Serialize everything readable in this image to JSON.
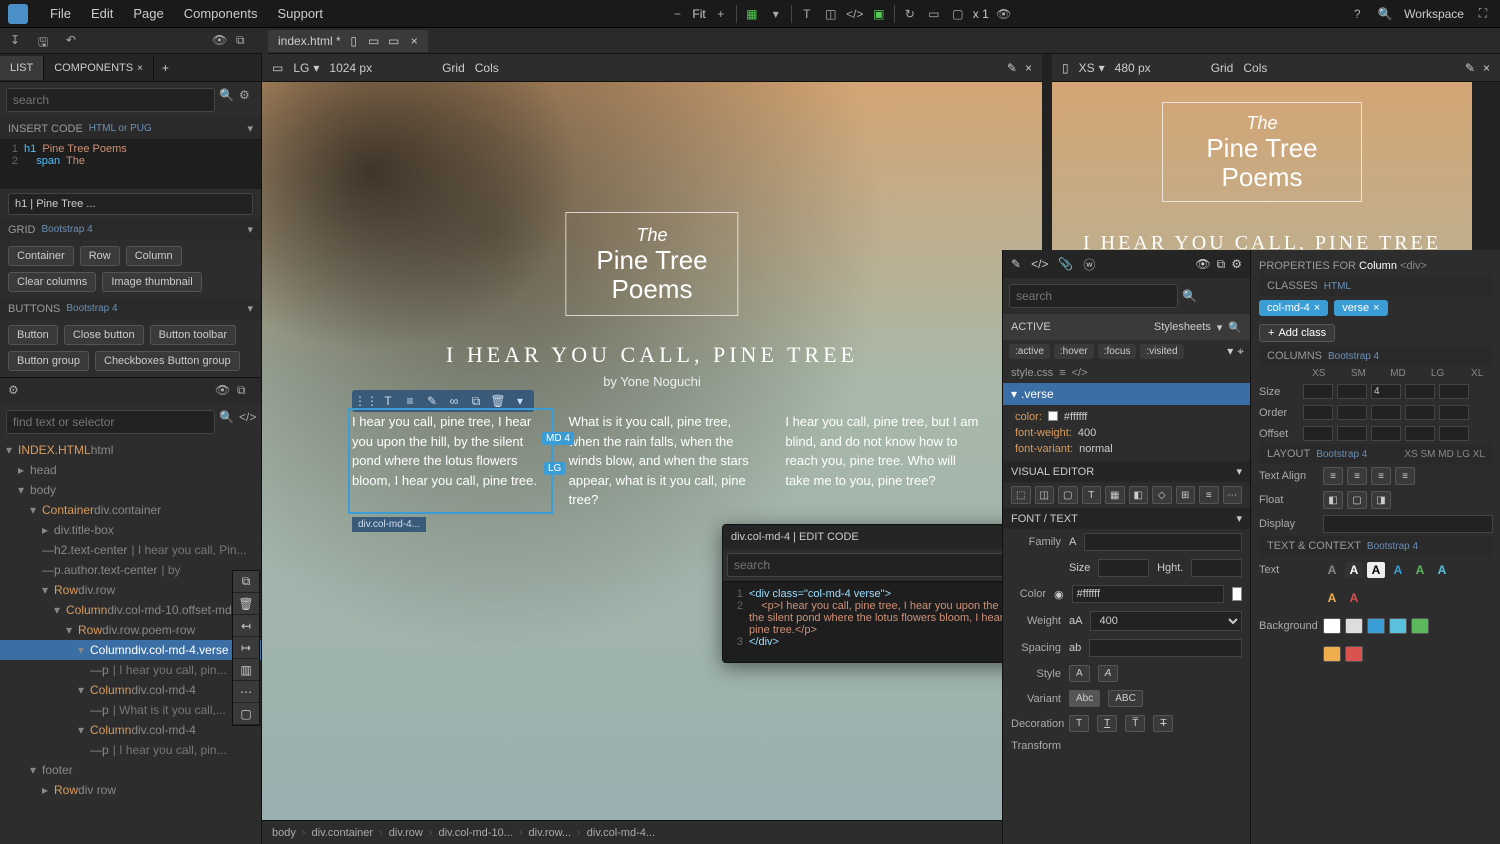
{
  "menubar": {
    "items": [
      "File",
      "Edit",
      "Page",
      "Components",
      "Support"
    ],
    "fit": "Fit",
    "x1": "x 1",
    "workspace": "Workspace"
  },
  "tab": {
    "filename": "index.html *"
  },
  "leftPanel": {
    "tabs": {
      "list": "LIST",
      "components": "COMPONENTS"
    },
    "searchPlaceholder": "search",
    "insertCode": {
      "label": "INSERT CODE",
      "sub": "HTML or PUG"
    },
    "codeLines": {
      "l1a": "h1",
      "l1b": "Pine Tree Poems",
      "l2a": "span",
      "l2b": "The"
    },
    "selectorPreview": "h1 | Pine Tree ...",
    "grid": {
      "label": "GRID",
      "sub": "Bootstrap 4",
      "buttons": [
        "Container",
        "Row",
        "Column",
        "Clear columns",
        "Image thumbnail"
      ]
    },
    "buttons": {
      "label": "BUTTONS",
      "sub": "Bootstrap 4",
      "buttons": [
        "Button",
        "Close button",
        "Button toolbar",
        "Button group",
        "Checkboxes Button group"
      ]
    },
    "treeSearchPlaceholder": "find text or selector",
    "treeRoot": {
      "file": "INDEX.HTML",
      "ext": "html"
    },
    "tree": {
      "head": "head",
      "body": "body",
      "container": {
        "tag": "Container",
        "cls": "div.container"
      },
      "titleBox": {
        "tag": "div.title-box"
      },
      "h2": {
        "tag": "h2.text-center",
        "text": "I hear you call, Pin..."
      },
      "author": {
        "tag": "p.author.text-center",
        "text": "by"
      },
      "row": {
        "tag": "Row",
        "cls": "div.row"
      },
      "col10": {
        "tag": "Column",
        "cls": "div.col-md-10.offset-md..."
      },
      "poemRow": {
        "tag": "Row",
        "cls": "div.row.poem-row"
      },
      "col4verse": {
        "tag": "Column",
        "cls": "div.col-md-4.verse"
      },
      "p1": {
        "tag": "p",
        "text": "I hear you call, pin..."
      },
      "col4b": {
        "tag": "Column",
        "cls": "div.col-md-4"
      },
      "p2": {
        "tag": "p",
        "text": "What is it you call,..."
      },
      "col4c": {
        "tag": "Column",
        "cls": "div.col-md-4"
      },
      "p3": {
        "tag": "p",
        "text": "I hear you call, pin..."
      },
      "footer": "footer",
      "rowLast": {
        "tag": "Row",
        "cls": "div row"
      }
    }
  },
  "viewLG": {
    "label": "LG",
    "size": "1024 px",
    "grid": "Grid",
    "cols": "Cols"
  },
  "viewXS": {
    "label": "XS",
    "size": "480 px",
    "grid": "Grid",
    "cols": "Cols"
  },
  "page": {
    "the": "The",
    "title1": "Pine Tree",
    "title2": "Poems",
    "h2": "I HEAR YOU CALL, PINE TREE",
    "author": "by Yone Noguchi",
    "verse1": "I hear you call, pine tree, I hear you upon the hill, by the silent pond where the lotus flowers bloom, I hear you call, pine tree.",
    "verse2": "What is it you call, pine tree, when the rain falls, when the winds blow, and when the stars appear, what is it you call, pine tree?",
    "verse3": "I hear you call, pine tree, but I am blind, and do not know how to reach you, pine tree. Who will take me to you, pine tree?",
    "badgeMD": "MD 4",
    "badgeLG": "LG",
    "selTag": "div.col-md-4..."
  },
  "breadcrumb": [
    "body",
    "div.container",
    "div.row",
    "div.col-md-10...",
    "div.row...",
    "div.col-md-4..."
  ],
  "codePopup": {
    "title": "div.col-md-4 | EDIT CODE",
    "searchPlaceholder": "search",
    "code": {
      "l1": "<div class=\"col-md-4 verse\">",
      "l2": "    <p>I hear you call, pine tree, I hear you upon the hill, by the silent pond where the lotus flowers bloom, I hear you call, pine tree.</p>",
      "l3": "</div>"
    }
  },
  "style": {
    "searchPlaceholder": "search",
    "active": "ACTIVE",
    "stylesheets": "Stylesheets",
    "pseudos": [
      ":active",
      ":hover",
      ":focus",
      ":visited"
    ],
    "file": "style.css",
    "rule": ".verse",
    "props": [
      {
        "n": "color:",
        "v": "#ffffff"
      },
      {
        "n": "font-weight:",
        "v": "400"
      },
      {
        "n": "font-variant:",
        "v": "normal"
      }
    ],
    "veHeader": "VISUAL EDITOR",
    "fontText": "FONT / TEXT",
    "family": "Family",
    "size": "Size",
    "hght": "Hght.",
    "color": "Color",
    "colorVal": "#ffffff",
    "weight": "Weight",
    "weightVal": "400",
    "spacing": "Spacing",
    "styleLbl": "Style",
    "variant": "Variant",
    "variantAbc": "Abc",
    "variantAbc2": "ABC",
    "decoration": "Decoration",
    "transform": "Transform"
  },
  "props": {
    "header": "PROPERTIES FOR",
    "element": "Column",
    "eltag": "<div>",
    "classesLbl": "CLASSES",
    "classesSub": "HTML",
    "chips": [
      "col-md-4",
      "verse"
    ],
    "addClass": "Add class",
    "columnsLbl": "COLUMNS",
    "columnsSub": "Bootstrap 4",
    "sizeCols": [
      "XS",
      "SM",
      "MD",
      "LG",
      "XL"
    ],
    "sizeLbl": "Size",
    "mdVal": "4",
    "orderLbl": "Order",
    "offsetLbl": "Offset",
    "layoutLbl": "LAYOUT",
    "layoutSub": "Bootstrap 4",
    "layoutCols": [
      "XS",
      "SM",
      "MD",
      "LG",
      "XL"
    ],
    "textAlign": "Text Align",
    "float": "Float",
    "display": "Display",
    "textContextLbl": "TEXT & CONTEXT",
    "textContextSub": "Bootstrap 4",
    "textLbl": "Text",
    "bgLbl": "Background"
  }
}
